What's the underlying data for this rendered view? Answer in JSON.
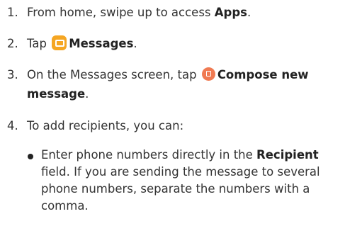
{
  "steps": [
    {
      "number": "1.",
      "pre": "From home, swipe up to access ",
      "bold": "Apps",
      "post": "."
    },
    {
      "number": "2.",
      "pre": "Tap",
      "icon": "messages-app-icon",
      "bold": "Messages",
      "post": "."
    },
    {
      "number": "3.",
      "pre": "On the Messages screen, tap",
      "icon": "compose-icon",
      "bold_line1": "Compose new",
      "bold_line2": "message",
      "post": "."
    },
    {
      "number": "4.",
      "text": "To add recipients, you can:"
    }
  ],
  "bullet": {
    "line1_pre": "Enter phone numbers directly in the ",
    "line1_bold": "Recipient",
    "line2": "field. If you are sending the message to several",
    "line3": "phone numbers, separate the numbers with a",
    "line4": "comma."
  },
  "colors": {
    "messages_icon": "#f5a623",
    "compose_icon": "#f07a52",
    "text": "#333333"
  }
}
